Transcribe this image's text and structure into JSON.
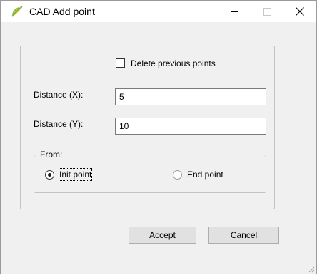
{
  "window": {
    "title": "CAD Add point",
    "app_icon": "qgis-leaf-icon"
  },
  "titlebar_buttons": {
    "minimize_icon": "minimize-icon",
    "maximize_icon": "maximize-icon",
    "close_icon": "close-icon"
  },
  "form": {
    "delete_previous_label": "Delete previous points",
    "delete_previous_checked": false,
    "distance_x_label": "Distance (X):",
    "distance_x_value": "5",
    "distance_y_label": "Distance (Y):",
    "distance_y_value": "10"
  },
  "from_group": {
    "title": "From:",
    "options": [
      {
        "label": "Init point",
        "selected": true
      },
      {
        "label": "End point",
        "selected": false
      }
    ]
  },
  "buttons": {
    "accept_label": "Accept",
    "cancel_label": "Cancel"
  },
  "colors": {
    "dialog_background": "#f0f0f0",
    "titlebar_background": "#ffffff",
    "icon_green": "#7db53f",
    "icon_yellow": "#f1c232"
  }
}
